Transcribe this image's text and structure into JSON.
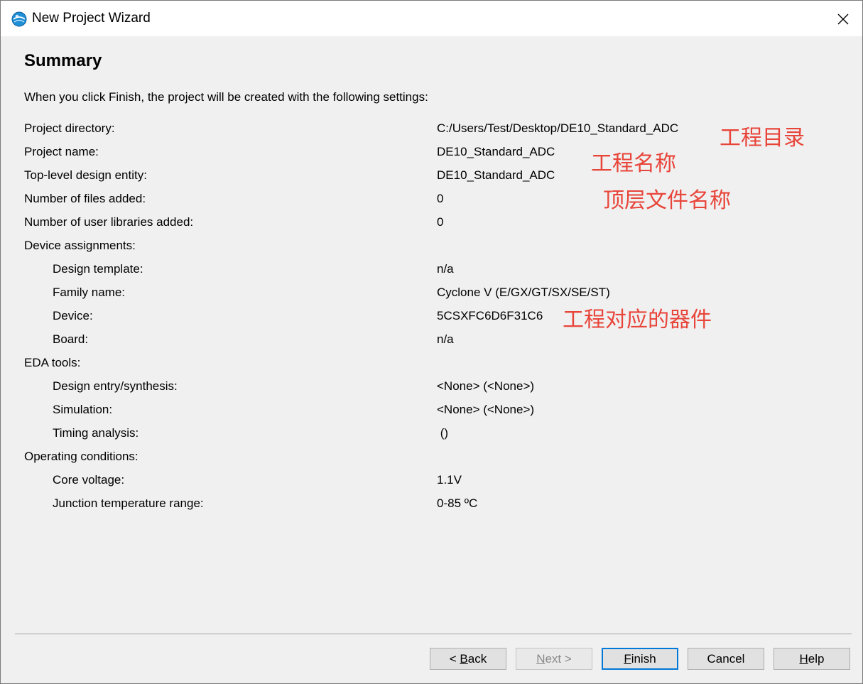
{
  "window": {
    "title": "New Project Wizard"
  },
  "page": {
    "heading": "Summary",
    "intro": "When you click Finish, the project will be created with the following settings:"
  },
  "rows": [
    {
      "label": "Project directory:",
      "value": "C:/Users/Test/Desktop/DE10_Standard_ADC",
      "indent": false
    },
    {
      "label": "Project name:",
      "value": "DE10_Standard_ADC",
      "indent": false
    },
    {
      "label": "Top-level design entity:",
      "value": "DE10_Standard_ADC",
      "indent": false
    },
    {
      "label": "Number of files added:",
      "value": "0",
      "indent": false
    },
    {
      "label": "Number of user libraries added:",
      "value": "0",
      "indent": false
    },
    {
      "label": "Device assignments:",
      "value": "",
      "indent": false
    },
    {
      "label": "Design template:",
      "value": "n/a",
      "indent": true
    },
    {
      "label": "Family name:",
      "value": "Cyclone V (E/GX/GT/SX/SE/ST)",
      "indent": true
    },
    {
      "label": "Device:",
      "value": "5CSXFC6D6F31C6",
      "indent": true
    },
    {
      "label": "Board:",
      "value": "n/a",
      "indent": true
    },
    {
      "label": "EDA tools:",
      "value": "",
      "indent": false
    },
    {
      "label": "Design entry/synthesis:",
      "value": "<None> (<None>)",
      "indent": true
    },
    {
      "label": "Simulation:",
      "value": "<None> (<None>)",
      "indent": true
    },
    {
      "label": "Timing analysis:",
      "value": " ()",
      "indent": true
    },
    {
      "label": "Operating conditions:",
      "value": "",
      "indent": false
    },
    {
      "label": "Core voltage:",
      "value": "1.1V",
      "indent": true
    },
    {
      "label": "Junction temperature range:",
      "value": "0-85 ºC",
      "indent": true
    }
  ],
  "annotations": {
    "project_directory": "工程目录",
    "project_name": "工程名称",
    "top_level": "顶层文件名称",
    "device": "工程对应的器件"
  },
  "buttons": {
    "back": {
      "prefix": "< ",
      "mnemonic": "B",
      "rest": "ack"
    },
    "next": {
      "mnemonic": "N",
      "rest": "ext >"
    },
    "finish": {
      "mnemonic": "F",
      "rest": "inish"
    },
    "cancel": {
      "label": "Cancel"
    },
    "help": {
      "mnemonic": "H",
      "rest": "elp"
    }
  },
  "colors": {
    "annotation": "#e8453a",
    "focus_border": "#0078d7",
    "window_bg": "#f0f0f0"
  },
  "icons": {
    "app": "quartus-globe-icon",
    "close": "close-icon"
  }
}
